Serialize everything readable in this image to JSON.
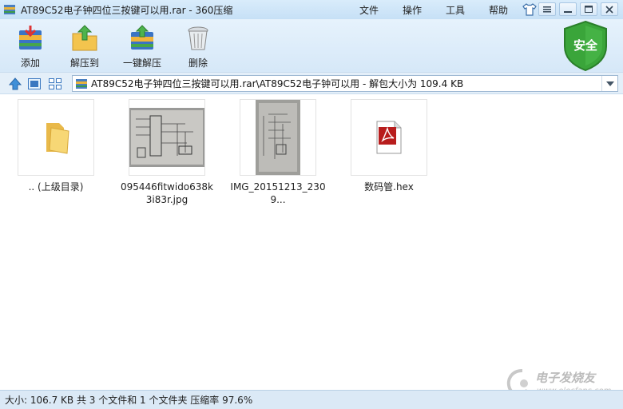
{
  "window": {
    "title": "AT89C52电子钟四位三按键可以用.rar - 360压缩",
    "menus": [
      "文件",
      "操作",
      "工具",
      "帮助"
    ]
  },
  "toolbar": {
    "buttons": [
      {
        "label": "添加",
        "icon": "add-archive-icon"
      },
      {
        "label": "解压到",
        "icon": "extract-to-icon"
      },
      {
        "label": "一键解压",
        "icon": "one-click-extract-icon"
      },
      {
        "label": "删除",
        "icon": "trash-icon"
      }
    ],
    "security_badge": "安全"
  },
  "address": {
    "path": "AT89C52电子钟四位三按键可以用.rar\\AT89C52电子钟可以用 - 解包大小为 109.4 KB"
  },
  "files": [
    {
      "name": ".. (上级目录)",
      "type": "folder-icon"
    },
    {
      "name": "095446fitwido638k3i83r.jpg",
      "type": "image-thumbnail"
    },
    {
      "name": "IMG_20151213_2309...",
      "type": "image-thumbnail"
    },
    {
      "name": "数码管.hex",
      "type": "pdf-file-icon"
    }
  ],
  "status": {
    "text": "大小: 106.7 KB 共 3 个文件和 1 个文件夹 压缩率 97.6%"
  },
  "watermark": {
    "text": "电子发烧友",
    "url": "www.elecfans.com"
  },
  "colors": {
    "title_bg": "#c6e0f6",
    "toolbar_bg": "#d6e8f8",
    "badge_green": "#3aa53a",
    "status_bg": "#dbe9f6"
  }
}
